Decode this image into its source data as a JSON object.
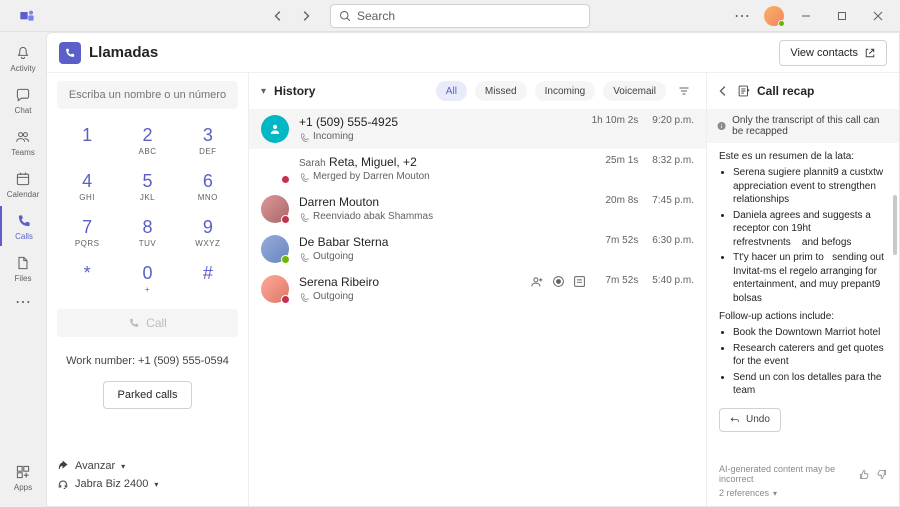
{
  "titlebar": {
    "search_placeholder": "Search"
  },
  "rail": {
    "activity": "Activity",
    "chat": "Chat",
    "teams": "Teams",
    "calendar": "Calendar",
    "calls": "Calls",
    "files": "Files",
    "apps": "Apps"
  },
  "page": {
    "title": "Llamadas",
    "view_contacts": "View contacts"
  },
  "dialer": {
    "placeholder": "Escriba un nombre o un número",
    "keys": [
      {
        "n": "1",
        "s": ""
      },
      {
        "n": "2",
        "s": "ABC"
      },
      {
        "n": "3",
        "s": "DEF"
      },
      {
        "n": "4",
        "s": "GHI"
      },
      {
        "n": "5",
        "s": "JKL"
      },
      {
        "n": "6",
        "s": "MNO"
      },
      {
        "n": "7",
        "s": "PQRS"
      },
      {
        "n": "8",
        "s": "TUV"
      },
      {
        "n": "9",
        "s": "WXYZ"
      },
      {
        "n": "*",
        "s": ""
      },
      {
        "n": "0",
        "s": "+"
      },
      {
        "n": "#",
        "s": ""
      }
    ],
    "call_label": "Call",
    "work_number": "Work number: +1 (509) 555-0594",
    "parked_label": "Parked calls",
    "forward_label": "Avanzar",
    "device_label": "Jabra Biz 2400"
  },
  "history": {
    "title": "History",
    "filters": {
      "all": "All",
      "missed": "Missed",
      "incoming": "Incoming",
      "voicemail": "Voicemail"
    },
    "rows": [
      {
        "name": "+1 (509) 555-4925",
        "sub": "Incoming",
        "dur": "1h 10m 2s",
        "time": "9:20 p.m.",
        "avatar": "teal",
        "selected": true
      },
      {
        "name": "Reta, Miguel, +2",
        "prefix": "Sarah",
        "sub": "Merged by Darren Mouton",
        "dur": "25m 1s",
        "time": "8:32 p.m.",
        "avatar": "img1",
        "presence": "busy"
      },
      {
        "name": "Darren Mouton",
        "sub": "Reenviado abak Shammas",
        "dur": "20m 8s",
        "time": "7:45 p.m.",
        "avatar": "img2",
        "presence": "busy",
        "forward": "Reenviado"
      },
      {
        "name": "De Babar Sterna",
        "sub": "Outgoing",
        "dur": "7m 52s",
        "time": "6:30 p.m.",
        "avatar": "img3",
        "presence": "avail"
      },
      {
        "name": "Serena Ribeiro",
        "sub": "Outgoing",
        "dur": "7m 52s",
        "time": "5:40 p.m.",
        "avatar": "img4",
        "presence": "busy",
        "actions": true
      }
    ]
  },
  "recap": {
    "title": "Call recap",
    "banner": "Only the transcript of this call can be recapped",
    "intro": "Este es un resumen de la lata:",
    "bullets1": [
      "Serena sugiere plannit9 a custxtw appreciation event to strengthen relationships",
      "Daniela agrees and suggests a receptor con 19ht refrestvnents    and befogs",
      "Tt'y hacer un prim to   sending out Invitat-ms el regelo arranging for entertainment, and muy prepant9 bolsas"
    ],
    "followup_label": "Follow-up actions include:",
    "bullets2": [
      "Book the Downtown Marriot hotel",
      "Research caterers and get quotes for the event",
      "Send un con los detalles para the team"
    ],
    "undo": "Undo",
    "disclaimer": "AI-generated content may be incorrect",
    "references": "2 references"
  }
}
